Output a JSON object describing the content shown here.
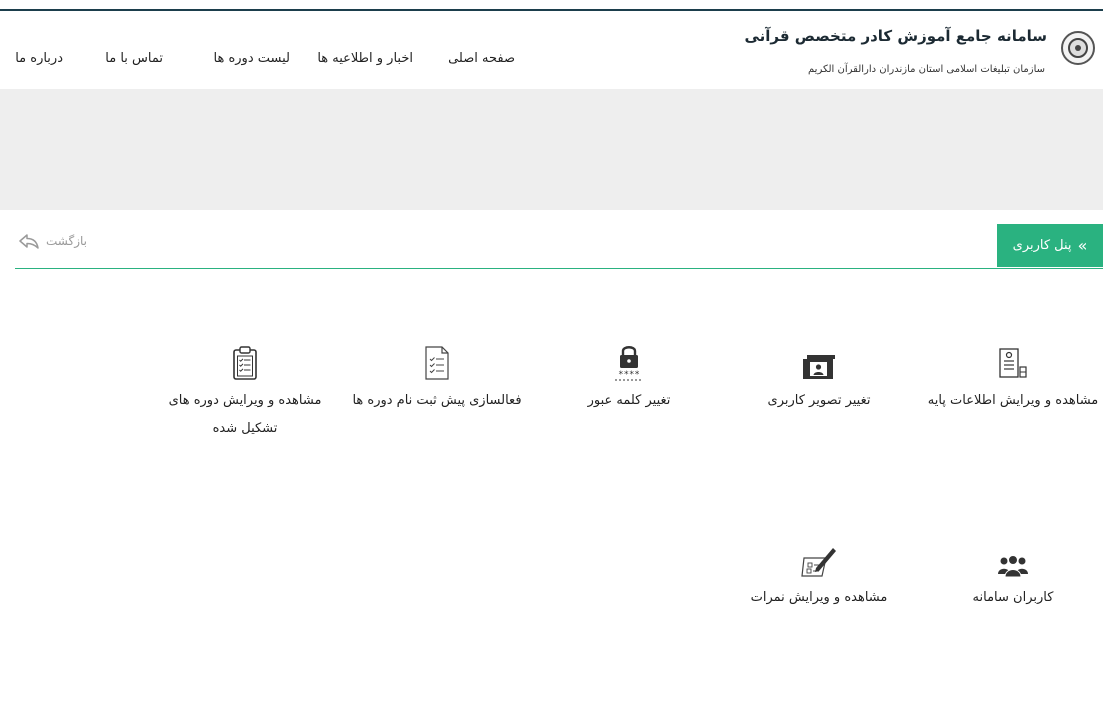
{
  "header": {
    "title": "سامانه جامع آموزش کادر متخصص قرآنی",
    "subtitle": "سازمان تبلیغات اسلامی استان مازندران دارالقرآن الکریم"
  },
  "nav": {
    "home": "صفحه اصلی",
    "news": "اخبار و اطلاعیه ها",
    "courses": "لیست دوره ها",
    "contact": "تماس با ما",
    "about": "درباره ما"
  },
  "panel": {
    "label": "پنل کاربری",
    "back_label": "بازگشت"
  },
  "tiles": [
    {
      "label": "مشاهده و ویرایش اطلاعات پایه",
      "icon": "profile-document-icon"
    },
    {
      "label": "تغییر تصویر کاربری",
      "icon": "user-picture-icon"
    },
    {
      "label": "تغییر کلمه عبور",
      "icon": "password-lock-icon"
    },
    {
      "label": "فعالسازی پیش ثبت نام دوره ها",
      "icon": "checklist-document-icon"
    },
    {
      "label": "مشاهده و ویرایش دوره های تشکیل شده",
      "icon": "clipboard-checklist-icon"
    },
    {
      "label": "کاربران سامانه",
      "icon": "users-group-icon"
    },
    {
      "label": "مشاهده و ویرایش نمرات",
      "icon": "edit-grades-icon"
    }
  ],
  "colors": {
    "accent": "#2ab280",
    "header_line": "#1c3f4d",
    "banner": "#eeeeee"
  }
}
